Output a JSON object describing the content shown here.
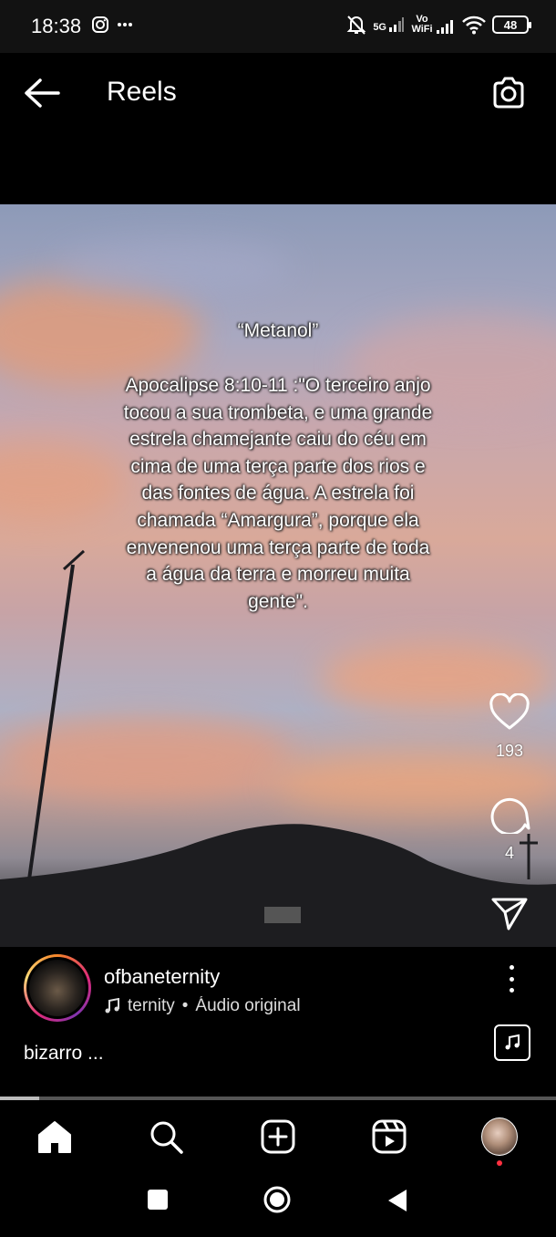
{
  "status_bar": {
    "time": "18:38",
    "left_icons": [
      "instagram-icon",
      "more-dots-icon"
    ],
    "network_5g": "5G",
    "vowifi": "Vo WiFi",
    "battery": "48"
  },
  "header": {
    "title": "Reels"
  },
  "reel": {
    "overlay_title": "“Metanol”",
    "overlay_body": "Apocalipse 8:10-11 :\"O terceiro anjo tocou a sua trombeta, e uma grande estrela chamejante caiu do céu em cima de uma terça parte dos rios e das fontes de água. A estrela foi chamada “Amargura”, porque ela envenenou uma terça parte de toda a água da terra e morreu muita gente\".",
    "likes": "193",
    "comments": "4",
    "author": "ofbaneternity",
    "audio_artist": "ternity",
    "audio_separator": "•",
    "audio_label": "Áudio original",
    "caption": "bizarro ...",
    "progress": 0.07
  },
  "nav": {
    "items": [
      "home-icon",
      "search-icon",
      "create-icon",
      "reels-icon",
      "profile-avatar"
    ]
  }
}
